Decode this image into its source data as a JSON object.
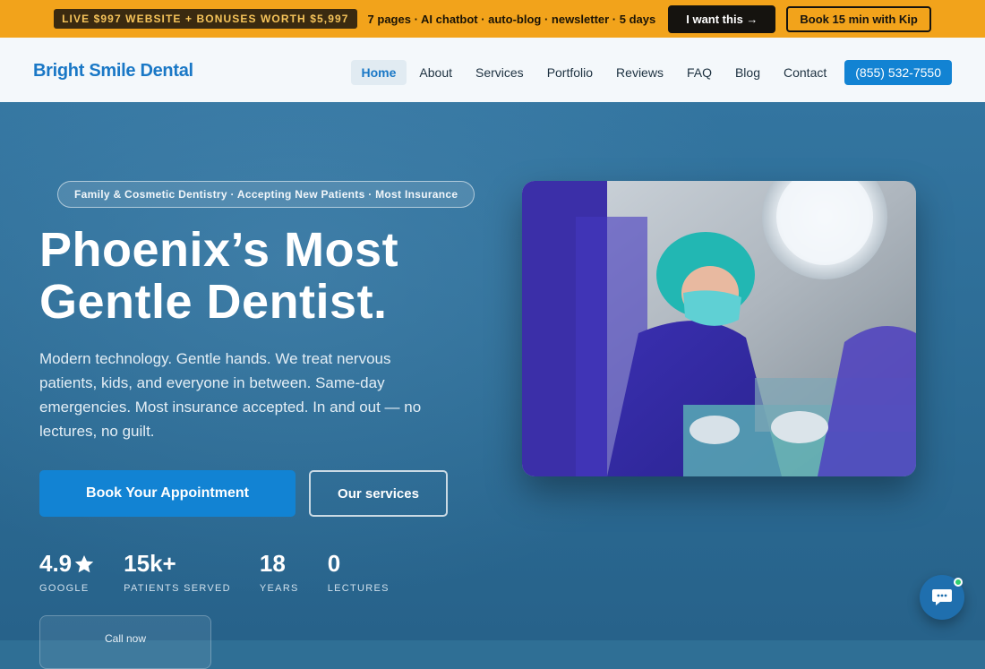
{
  "promo": {
    "badge": "LIVE $997 WEBSITE + BONUSES WORTH $5,997",
    "text": "7 pages · AI chatbot · auto-blog · newsletter · 5 days",
    "cta": "I want this →",
    "book": "Book 15 min with Kip"
  },
  "nav": {
    "logo": "Bright Smile Dental",
    "links": [
      "Home",
      "About",
      "Services",
      "Portfolio",
      "Reviews",
      "FAQ",
      "Blog",
      "Contact"
    ],
    "active": "Home",
    "phone": "(855) 532-7550"
  },
  "hero": {
    "pill": "Family & Cosmetic Dentistry · Accepting New Patients · Most Insurance",
    "headline": "Phoenix’s Most Gentle Dentist.",
    "subcopy": "Modern technology. Gentle hands. We treat nervous patients, kids, and everyone in between. Same-day emergencies. Most insurance accepted. In and out — no lectures, no guilt.",
    "primary_button": "Book Your Appointment",
    "secondary_button": "Our services",
    "stats": [
      {
        "value": "4.9",
        "label": "GOOGLE",
        "icon": "star-icon"
      },
      {
        "value": "15k+",
        "label": "PATIENTS SERVED"
      },
      {
        "value": "18",
        "label": "YEARS"
      },
      {
        "value": "0",
        "label": "LECTURES"
      }
    ],
    "call_card": "Call now"
  },
  "photo": {
    "alt_icon": "dentist-surgery-photo"
  },
  "chat": {
    "icon": "chat-bubble-icon",
    "status_color": "#2fd06f"
  },
  "colors": {
    "promo_bg": "#f2a31b",
    "brand_blue": "#1283d3",
    "hero_bg": "#2f6f95"
  }
}
